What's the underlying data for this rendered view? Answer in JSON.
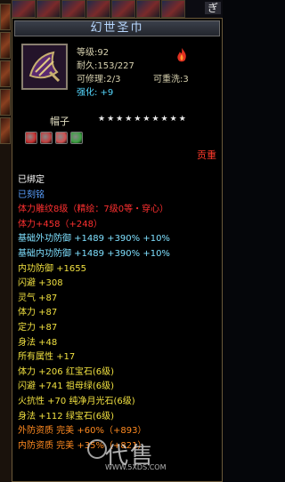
{
  "top_bar": {
    "tag": "ぎ"
  },
  "tooltip": {
    "title": "幻世圣巾",
    "info_lines": [
      "等级:92",
      "耐久:153/227",
      "可修理:2/3",
      "强化: +9"
    ],
    "rewash_text": "可重洗:3",
    "item_type": "帽子",
    "stars_total": 10,
    "stars_lit": 10,
    "tribute_label": "贡重",
    "gem_colors": [
      "#c83030",
      "#c04040",
      "#d05050",
      "#3aa040"
    ],
    "stats": [
      {
        "text": "已绑定",
        "color": "#ffffff"
      },
      {
        "text": "已刻铭",
        "color": "#5aa0ff"
      },
      {
        "text": "体力雕纹8级（精绘：7级0等・穿心）",
        "color": "#ff3030"
      },
      {
        "text": "体力+458（+248）",
        "color": "#ff3030"
      },
      {
        "text": "基础外功防御 +1489 +390% +10%",
        "color": "#7fe0ff"
      },
      {
        "text": "基础内功防御 +1489 +390% +10%",
        "color": "#7fe0ff"
      },
      {
        "text": "内功防御 +1655",
        "color": "#f0e040"
      },
      {
        "text": "闪避 +308",
        "color": "#f0e040"
      },
      {
        "text": "灵气 +87",
        "color": "#f0e040"
      },
      {
        "text": "体力 +87",
        "color": "#f0e040"
      },
      {
        "text": "定力 +87",
        "color": "#f0e040"
      },
      {
        "text": "身法 +48",
        "color": "#f0e040"
      },
      {
        "text": "所有属性 +17",
        "color": "#f0e040"
      },
      {
        "text": "体力 +206 红宝石(6级)",
        "color": "#f0e040"
      },
      {
        "text": "闪避 +741 祖母绿(6级)",
        "color": "#f0e040"
      },
      {
        "text": "火抗性 +70 纯净月光石(6级)",
        "color": "#f0e040"
      },
      {
        "text": "身法 +112 绿宝石(6级)",
        "color": "#f0e040"
      },
      {
        "text": "外防资质 完美 +60%（+893）",
        "color": "#ff8a20"
      },
      {
        "text": "内防资质 完美 +35%（+821）",
        "color": "#ff8a20"
      }
    ]
  },
  "watermark": {
    "brand": "代售",
    "url": "WWW.5XDS.COM"
  }
}
